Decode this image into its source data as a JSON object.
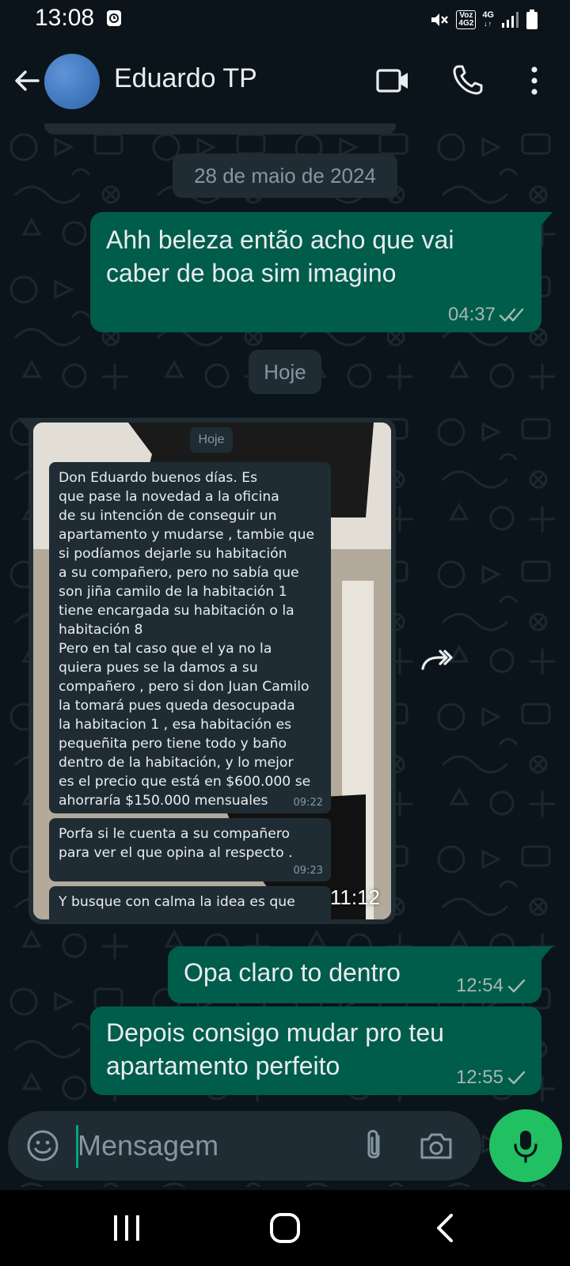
{
  "status_bar": {
    "time": "13:08",
    "volte_label": "Voz\n4G2",
    "network_label": "4G"
  },
  "header": {
    "contact_name": "Eduardo TP"
  },
  "chat": {
    "date_chip_1": "28 de maio de 2024",
    "date_chip_2": "Hoje",
    "messages": [
      {
        "direction": "out",
        "text": "Ahh beleza então acho que vai caber de boa sim imagino",
        "time": "04:37",
        "status": "read"
      },
      {
        "direction": "in",
        "type": "image",
        "time": "11:12",
        "screenshot": {
          "chip": "Hoje",
          "bubbles": [
            {
              "text": "Don Eduardo  buenos días.  Es\nque pase la novedad a la oficina\nde su intención de  conseguir un\napartamento y mudarse , tambie que\nsi podíamos dejarle su habitación\na su compañero, pero no sabía que\nson jiña camilo de la habitación 1\ntiene encargada su habitación o la\nhabitación 8\nPero en tal caso que el ya no  la\nquiera pues  se la damos a su\ncompañero , pero si don Juan Camilo\nla tomará pues queda desocupada\nla habitacion 1 , esa habitación es\npequeñita pero tiene todo y baño\ndentro de la habitación, y lo mejor\nes el precio que está en $600.000 se\nahorraría $150.000 mensuales",
              "time": "09:22"
            },
            {
              "text": "Porfa si le cuenta a su compañero\npara ver el que opina al respecto .",
              "time": "09:23"
            },
            {
              "text": "Y busque con calma la idea es que",
              "time": ""
            }
          ]
        }
      },
      {
        "direction": "out",
        "text": "Opa claro to dentro",
        "time": "12:54",
        "status": "sent"
      },
      {
        "direction": "out",
        "text": "Depois consigo mudar pro teu apartamento perfeito",
        "time": "12:55",
        "status": "sent"
      }
    ]
  },
  "input": {
    "placeholder": "Mensagem"
  },
  "colors": {
    "background": "#0b141a",
    "outgoing_bubble": "#005c4b",
    "incoming_bubble": "#1f2c34",
    "accent": "#21c063"
  },
  "icons": {
    "back": "arrow-left-icon",
    "video": "video-camera-icon",
    "call": "phone-icon",
    "menu": "more-vertical-icon",
    "emoji": "emoji-icon",
    "attach": "paperclip-icon",
    "camera": "camera-icon",
    "mic": "microphone-icon",
    "forward": "forward-icon"
  }
}
